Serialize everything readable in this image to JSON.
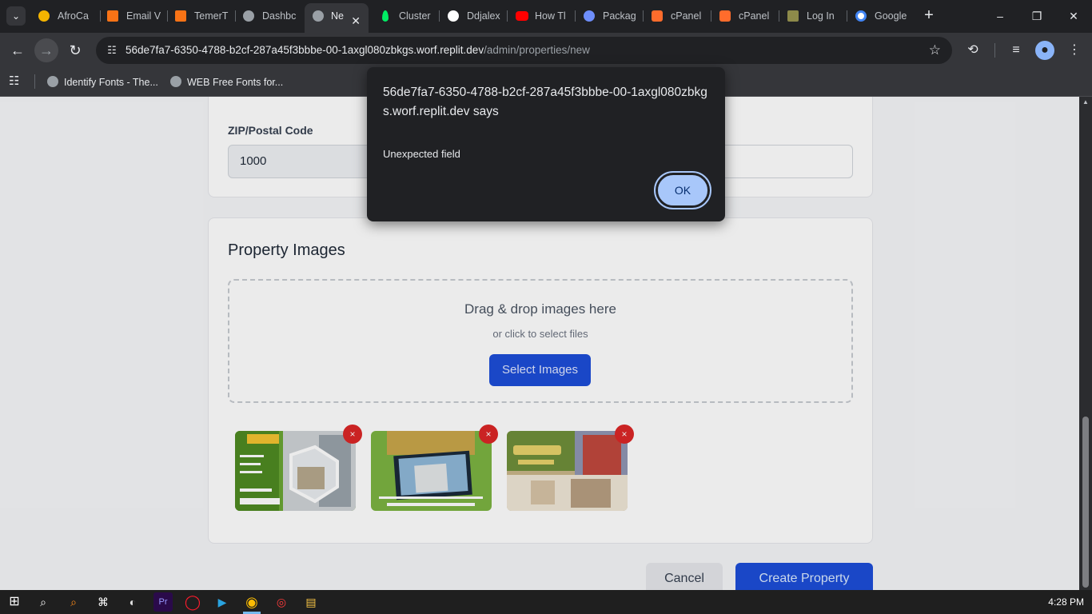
{
  "browser": {
    "tabs": [
      {
        "title": "AfroCa",
        "icon": "afrocart-icon",
        "color": "#f4b400"
      },
      {
        "title": "Email V",
        "icon": "orange-app-icon",
        "color": "#f97316"
      },
      {
        "title": "TemerT",
        "icon": "orange-app-icon",
        "color": "#f97316"
      },
      {
        "title": "Dashbc",
        "icon": "globe-icon",
        "color": "#9aa0a6"
      },
      {
        "title": "Ne",
        "icon": "globe-icon",
        "color": "#9aa0a6",
        "active": true
      },
      {
        "title": "Cluster",
        "icon": "mongodb-leaf-icon",
        "color": "#00ed64"
      },
      {
        "title": "Ddjalex",
        "icon": "github-icon",
        "color": "#ffffff"
      },
      {
        "title": "How Tl",
        "icon": "youtube-icon",
        "color": "#ff0000"
      },
      {
        "title": "Packag",
        "icon": "web-icon",
        "color": "#6e8efb"
      },
      {
        "title": "cPanel",
        "icon": "cpanel-icon",
        "color": "#ff6c2c"
      },
      {
        "title": "cPanel",
        "icon": "cpanel-icon",
        "color": "#ff6c2c"
      },
      {
        "title": "Log In",
        "icon": "login-icon",
        "color": "#8d8a4a"
      },
      {
        "title": "Google",
        "icon": "google-icon",
        "color": "#4285f4"
      }
    ],
    "new_tab_label": "+",
    "address": {
      "host": "56de7fa7-6350-4788-b2cf-287a45f3bbbe-00-1axgl080zbkgs.worf.replit.dev",
      "path": "/admin/properties/new"
    },
    "bookmarks": [
      {
        "label": "Identify Fonts - The..."
      },
      {
        "label": "WEB Free Fonts for..."
      }
    ]
  },
  "form": {
    "zip_label": "ZIP/Postal Code",
    "zip_value": "1000",
    "images_section_title": "Property Images",
    "dropzone_title": "Drag & drop images here",
    "dropzone_subtitle": "or click to select files",
    "select_images_label": "Select Images",
    "cancel_label": "Cancel",
    "create_label": "Create Property",
    "remove_symbol": "×"
  },
  "dialog": {
    "title": "56de7fa7-6350-4788-b2cf-287a45f3bbbe-00-1axgl080zbkgs.worf.replit.dev says",
    "message": "Unexpected field",
    "ok_label": "OK"
  },
  "taskbar": {
    "time": "4:28 PM"
  },
  "colors": {
    "accent_blue": "#1d4ed8",
    "danger_red": "#dc2626",
    "dialog_button": "#a8c7fa"
  }
}
